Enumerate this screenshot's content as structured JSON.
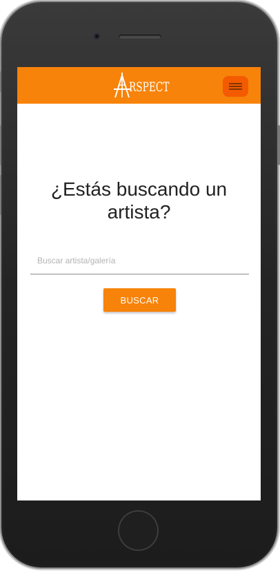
{
  "header": {
    "logo_initial": "A",
    "logo_rest": "RSPECT",
    "menu_icon": "hamburger-icon"
  },
  "main": {
    "title": "¿Estás buscando un artista?",
    "search_placeholder": "Buscar artista/galería",
    "search_value": "",
    "search_button_label": "BUSCAR"
  },
  "colors": {
    "brand_orange": "#f7830a",
    "menu_button": "#f45a00",
    "phone_body": "#2a2a2a"
  }
}
